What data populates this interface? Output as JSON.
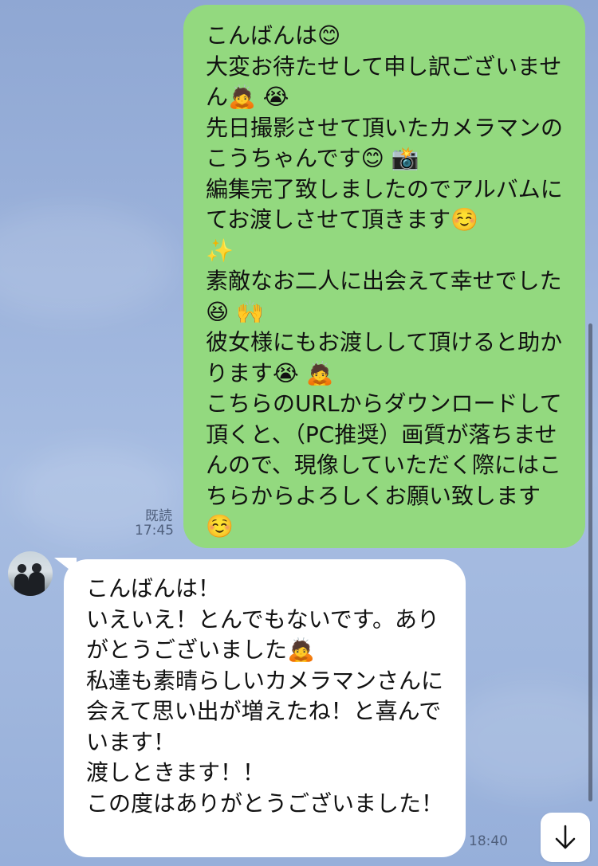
{
  "messages": {
    "outgoing": {
      "text": "こんばんは😊\n大変お待たせして申し訳ございません🙇 😭\n先日撮影させて頂いたカメラマンのこうちゃんです😊 📸\n編集完了致しましたのでアルバムにてお渡しさせて頂きます☺️\n✨\n素敵なお二人に出会えて幸せでした😆 🙌\n彼女様にもお渡しして頂けると助かります😭 🙇\nこちらのURLからダウンロードして頂くと、（PC推奨）画質が落ちませんので、現像していただく際にはこちらからよろしくお願い致します☺️",
      "read_label": "既読",
      "time": "17:45"
    },
    "incoming": {
      "text": "こんばんは！\nいえいえ！とんでもないです。ありがとうございました🙇\n私達も素晴らしいカメラマンさんに会えて思い出が増えたね！と喜んでいます！\n渡しときます！！\nこの度はありがとうございました！",
      "time": "18:40"
    }
  },
  "controls": {
    "scroll_down_icon": "arrow-down-icon"
  },
  "colors": {
    "outgoing_bubble": "#93d97f",
    "incoming_bubble": "#ffffff",
    "meta_text": "#4f5f7c"
  }
}
